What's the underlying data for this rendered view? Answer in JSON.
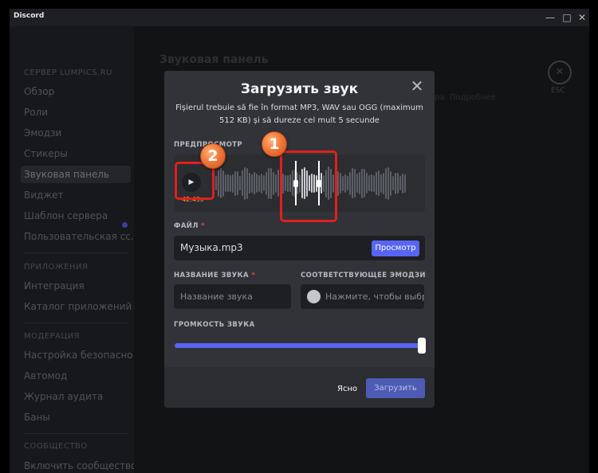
{
  "window": {
    "title": "Discord",
    "minimize_icon": "minimize-icon",
    "maximize_icon": "maximize-icon",
    "close_icon": "close-icon"
  },
  "sidebar": {
    "server_header": "СЕРВЕР LUMPICS.RU",
    "items": [
      {
        "label": "Обзор"
      },
      {
        "label": "Роли"
      },
      {
        "label": "Эмодзи"
      },
      {
        "label": "Стикеры"
      },
      {
        "label": "Звуковая панель",
        "active": true
      },
      {
        "label": "Виджет"
      },
      {
        "label": "Шаблон сервера"
      },
      {
        "label": "Пользовательская сс..."
      }
    ],
    "apps_header": "ПРИЛОЖЕНИЯ",
    "app_items": [
      {
        "label": "Интеграция"
      },
      {
        "label": "Каталог приложений"
      }
    ],
    "moderation_header": "МОДЕРАЦИЯ",
    "moderation_items": [
      {
        "label": "Настройка безопасно..."
      },
      {
        "label": "Автомод"
      },
      {
        "label": "Журнал аудита"
      },
      {
        "label": "Баны"
      }
    ],
    "community_header": "СООБЩЕСТВО",
    "community_items": [
      {
        "label": "Включить сообщество"
      }
    ]
  },
  "background": {
    "page_title": "Звуковая панель",
    "partial_text": "сервера. Подробнее",
    "esc_label": "ESC"
  },
  "modal": {
    "title": "Загрузить звук",
    "close_icon": "close-icon",
    "subtitle": "Fișierul trebuie să fie în format MP3, WAV sau OGG (maximum 512 KB) și să dureze cel mult 5 secunde",
    "preview_label": "ПРЕДПРОСМОТР",
    "play_icon": "play-icon",
    "duration": "42.49s",
    "file_label": "ФАЙЛ",
    "file_name": "Музыка.mp3",
    "browse_button": "Просмотр",
    "sound_name_label": "НАЗВАНИЕ ЗВУКА",
    "sound_name_placeholder": "Название звука",
    "emoji_label": "СООТВЕТСТВУЮЩЕЕ ЭМОДЗИ",
    "emoji_placeholder": "Нажмите, чтобы выбр",
    "volume_label": "ГРОМКОСТЬ ЗВУКА",
    "volume_level": 1.0,
    "cancel_button": "Ясно",
    "upload_button": "Загрузить",
    "required_marker": "*"
  },
  "annotations": {
    "callout_1": "1",
    "callout_2": "2",
    "color": "#e0201f"
  },
  "colors": {
    "accent": "#5865f2",
    "modal_bg": "#313338",
    "input_bg": "#1e1f22",
    "duration_color": "#f0b232"
  }
}
